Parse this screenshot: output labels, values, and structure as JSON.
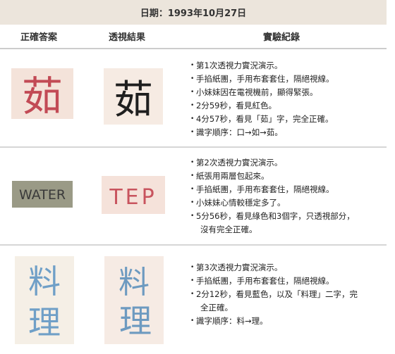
{
  "date_label": "日期：1993年10月27日",
  "headers": {
    "correct": "正確答案",
    "result": "透視結果",
    "record": "實驗紀錄"
  },
  "rows": [
    {
      "correct_char": "茹",
      "result_char": "茹",
      "notes": [
        "第1次透視力實況演示。",
        "手掐紙團，手用布套套住，隔絕視線。",
        "小妹妹因在電視機前，顯得緊張。",
        "2分59秒，看見紅色。",
        "4分57秒，看見「茹」字，完全正確。",
        "識字順序：口→如→茹。"
      ]
    },
    {
      "correct_word": "WATER",
      "result_word": "TEP",
      "notes": [
        "第2次透視力實況演示。",
        "紙張用兩層包起來。",
        "手掐紙團，手用布套套住，隔絕視線。",
        "小妹妹心情較穩定多了。",
        "5分56秒，看見綠色和3個字，只透視部分，",
        "沒有完全正確。"
      ]
    },
    {
      "correct_chars": [
        "料",
        "理"
      ],
      "result_chars": [
        "料",
        "理"
      ],
      "notes": [
        "第3次透視力實況演示。",
        "手掐紙團，手用布套套住，隔絕視線。",
        "2分12秒，看見藍色，以及「料理」二字，完",
        "全正確。",
        "識字順序：料→理。"
      ]
    }
  ],
  "colors": {
    "paper": "#f4e6dd",
    "red_ink": "#c0404e",
    "black_ink": "#222222",
    "green_card": "#9a9a84",
    "blue_ink": "#6f9fc7",
    "header_bg": "#ece5dc"
  }
}
